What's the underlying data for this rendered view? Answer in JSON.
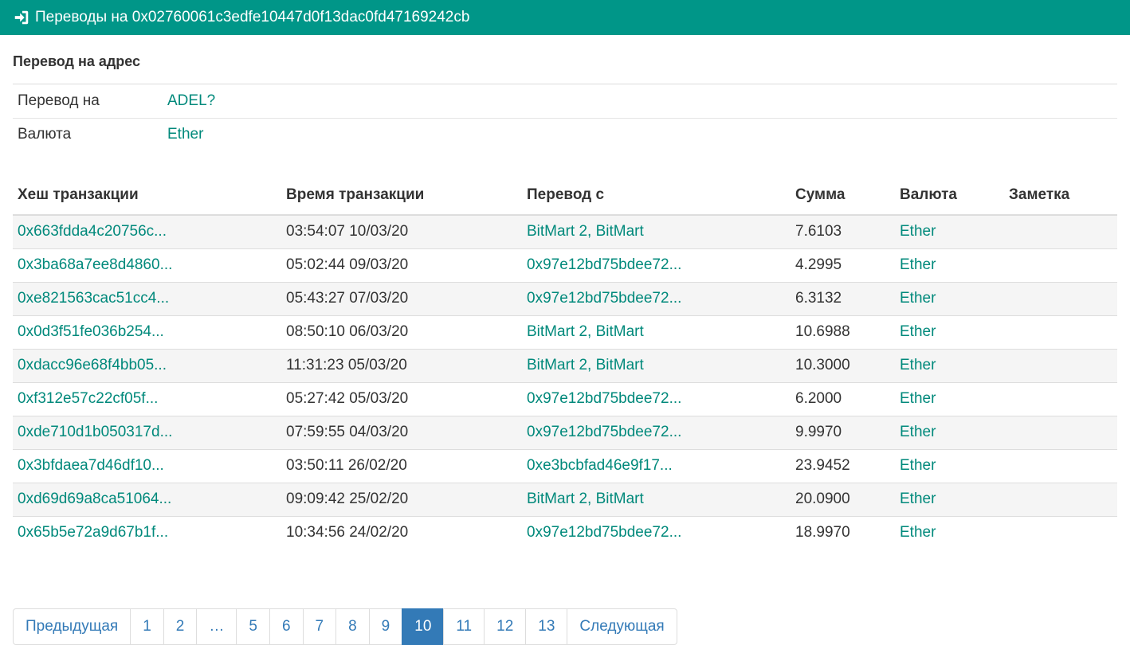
{
  "header": {
    "title": "Переводы на 0x02760061c3edfe10447d0f13dac0fd47169242cb",
    "icon": "sign-in-icon"
  },
  "section": {
    "title": "Перевод на адрес"
  },
  "info": [
    {
      "key": "Перевод на",
      "value": "ADEL?"
    },
    {
      "key": "Валюта",
      "value": "Ether"
    }
  ],
  "table": {
    "headers": [
      "Хеш транзакции",
      "Время транзакции",
      "Перевод с",
      "Сумма",
      "Валюта",
      "Заметка"
    ],
    "rows": [
      [
        "0x663fdda4c20756c...",
        "03:54:07 10/03/20",
        "BitMart 2, BitMart",
        "7.6103",
        "Ether",
        ""
      ],
      [
        "0x3ba68a7ee8d4860...",
        "05:02:44 09/03/20",
        "0x97e12bd75bdee72...",
        "4.2995",
        "Ether",
        ""
      ],
      [
        "0xe821563cac51cc4...",
        "05:43:27 07/03/20",
        "0x97e12bd75bdee72...",
        "6.3132",
        "Ether",
        ""
      ],
      [
        "0x0d3f51fe036b254...",
        "08:50:10 06/03/20",
        "BitMart 2, BitMart",
        "10.6988",
        "Ether",
        ""
      ],
      [
        "0xdacc96e68f4bb05...",
        "11:31:23 05/03/20",
        "BitMart 2, BitMart",
        "10.3000",
        "Ether",
        ""
      ],
      [
        "0xf312e57c22cf05f...",
        "05:27:42 05/03/20",
        "0x97e12bd75bdee72...",
        "6.2000",
        "Ether",
        ""
      ],
      [
        "0xde710d1b050317d...",
        "07:59:55 04/03/20",
        "0x97e12bd75bdee72...",
        "9.9970",
        "Ether",
        ""
      ],
      [
        "0x3bfdaea7d46df10...",
        "03:50:11 26/02/20",
        "0xe3bcbfad46e9f17...",
        "23.9452",
        "Ether",
        ""
      ],
      [
        "0xd69d69a8ca51064...",
        "09:09:42 25/02/20",
        "BitMart 2, BitMart",
        "20.0900",
        "Ether",
        ""
      ],
      [
        "0x65b5e72a9d67b1f...",
        "10:34:56 24/02/20",
        "0x97e12bd75bdee72...",
        "18.9970",
        "Ether",
        ""
      ]
    ]
  },
  "pagination": {
    "items": [
      "Предыдущая",
      "1",
      "2",
      "…",
      "5",
      "6",
      "7",
      "8",
      "9",
      "10",
      "11",
      "12",
      "13",
      "Следующая"
    ],
    "active": "10"
  },
  "colors": {
    "header_bg": "#009688",
    "link": "#00897b",
    "pager_link": "#337ab7",
    "pager_active": "#337ab7"
  }
}
